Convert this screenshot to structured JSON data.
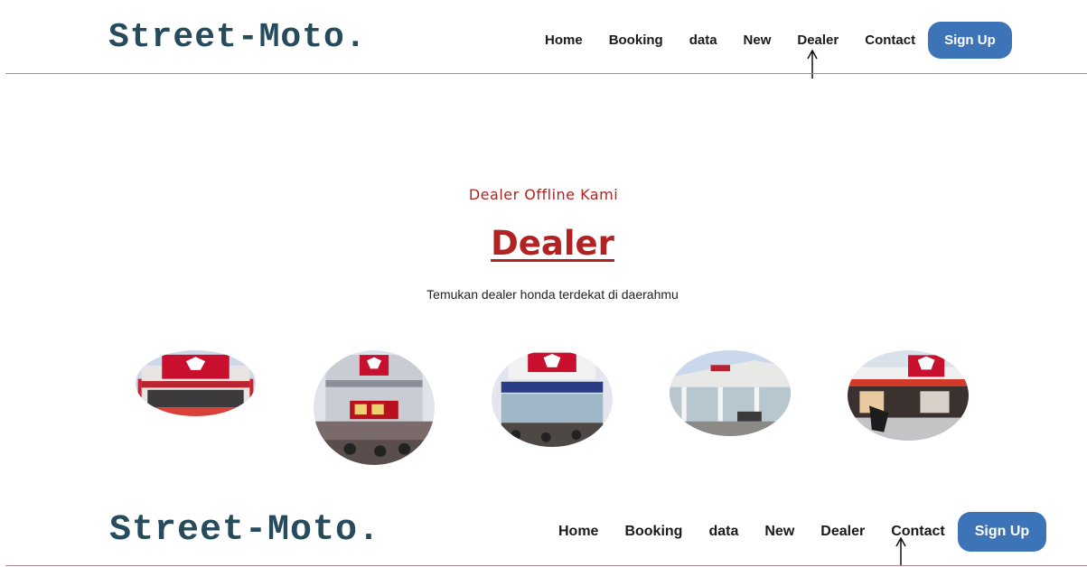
{
  "header": {
    "brand": "Street-Moto.",
    "nav": [
      "Home",
      "Booking",
      "data",
      "New",
      "Dealer",
      "Contact"
    ],
    "signup": "Sign Up"
  },
  "footer": {
    "brand": "Street-Moto.",
    "nav": [
      "Home",
      "Booking",
      "data",
      "New",
      "Dealer",
      "Contact"
    ],
    "signup": "Sign Up"
  },
  "section": {
    "subtitle": "Dealer Offline Kami",
    "title": "Dealer",
    "description": "Temukan dealer honda terdekat di daerahmu"
  },
  "dealers": [
    {
      "image": "dealer-photo-1"
    },
    {
      "image": "dealer-photo-2"
    },
    {
      "image": "dealer-photo-3"
    },
    {
      "image": "dealer-photo-4"
    },
    {
      "image": "dealer-photo-5"
    }
  ],
  "colors": {
    "brand": "#254b5c",
    "accent": "#b12222",
    "button": "#3d74b8",
    "rule": "#b3868a"
  }
}
